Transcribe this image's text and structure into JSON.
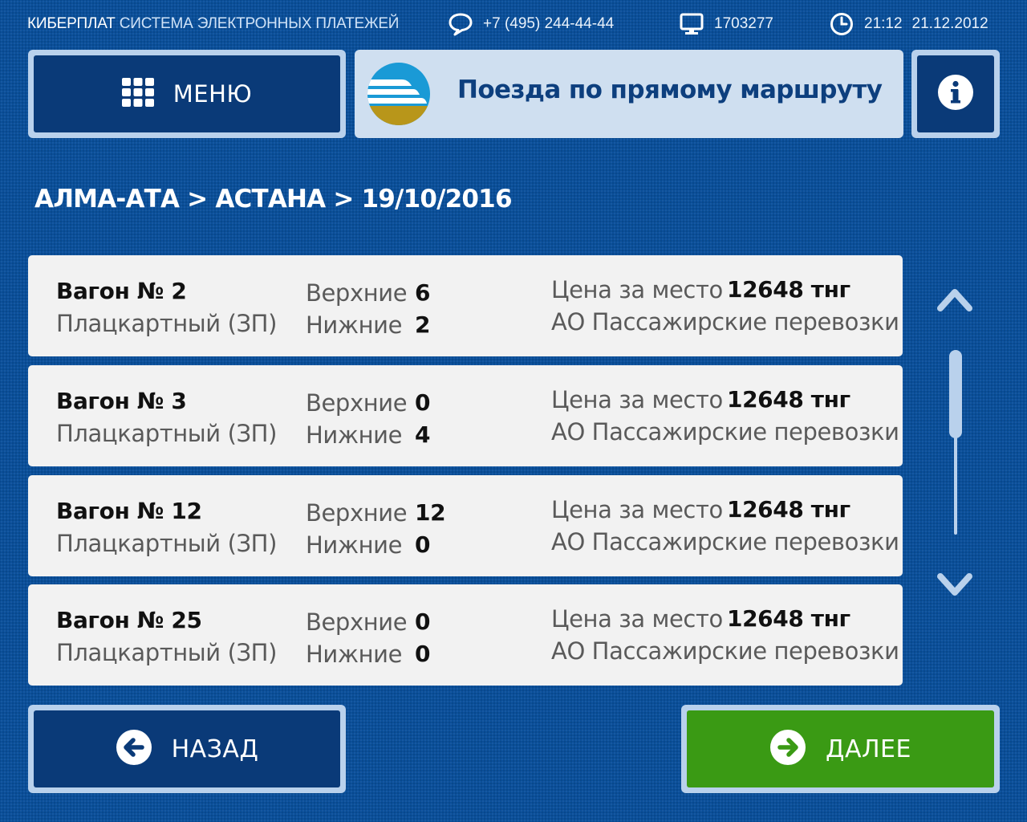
{
  "header": {
    "brand_bold": "КИБЕРПЛАТ",
    "brand_rest": "СИСТЕМА ЭЛЕКТРОННЫХ ПЛАТЕЖЕЙ",
    "phone": "+7 (495) 244-44-44",
    "terminal_id": "1703277",
    "time": "21:12",
    "date": "21.12.2012"
  },
  "menu_button": {
    "label": "МЕНЮ",
    "icon": "grid-icon"
  },
  "title": {
    "text": "Поезда по прямому маршруту",
    "logo": "railway-logo"
  },
  "info_button": {
    "icon": "info-icon"
  },
  "route": {
    "text": "АЛМА-АТА > АСТАНА > 19/10/2016"
  },
  "wagons": [
    {
      "wagon": "Вагон № 2",
      "type": "Плацкартный (ЗП)",
      "upper_label": "Верхние",
      "upper": "6",
      "lower_label": "Нижние",
      "lower": "2",
      "price_label": "Цена за место",
      "price": "12648 тнг",
      "carrier": "АО Пассажирские перевозки"
    },
    {
      "wagon": "Вагон № 3",
      "type": "Плацкартный (ЗП)",
      "upper_label": "Верхние",
      "upper": "0",
      "lower_label": "Нижние",
      "lower": "4",
      "price_label": "Цена за место",
      "price": "12648 тнг",
      "carrier": "АО Пассажирские перевозки"
    },
    {
      "wagon": "Вагон № 12",
      "type": "Плацкартный (ЗП)",
      "upper_label": "Верхние",
      "upper": "12",
      "lower_label": "Нижние",
      "lower": "0",
      "price_label": "Цена за место",
      "price": "12648 тнг",
      "carrier": "АО Пассажирские перевозки"
    },
    {
      "wagon": "Вагон № 25",
      "type": "Плацкартный (ЗП)",
      "upper_label": "Верхние",
      "upper": "0",
      "lower_label": "Нижние",
      "lower": "0",
      "price_label": "Цена за место",
      "price": "12648 тнг",
      "carrier": "АО Пассажирские перевозки"
    }
  ],
  "back_button": {
    "label": "НАЗАД",
    "icon": "arrow-left-circle-icon"
  },
  "next_button": {
    "label": "ДАЛЕЕ",
    "icon": "arrow-right-circle-icon"
  },
  "colors": {
    "background": "#0a4f9a",
    "button_dark": "#0a3a78",
    "button_border": "#b9d1ec",
    "next_green": "#3a9a14",
    "card": "#f2f2f2"
  }
}
